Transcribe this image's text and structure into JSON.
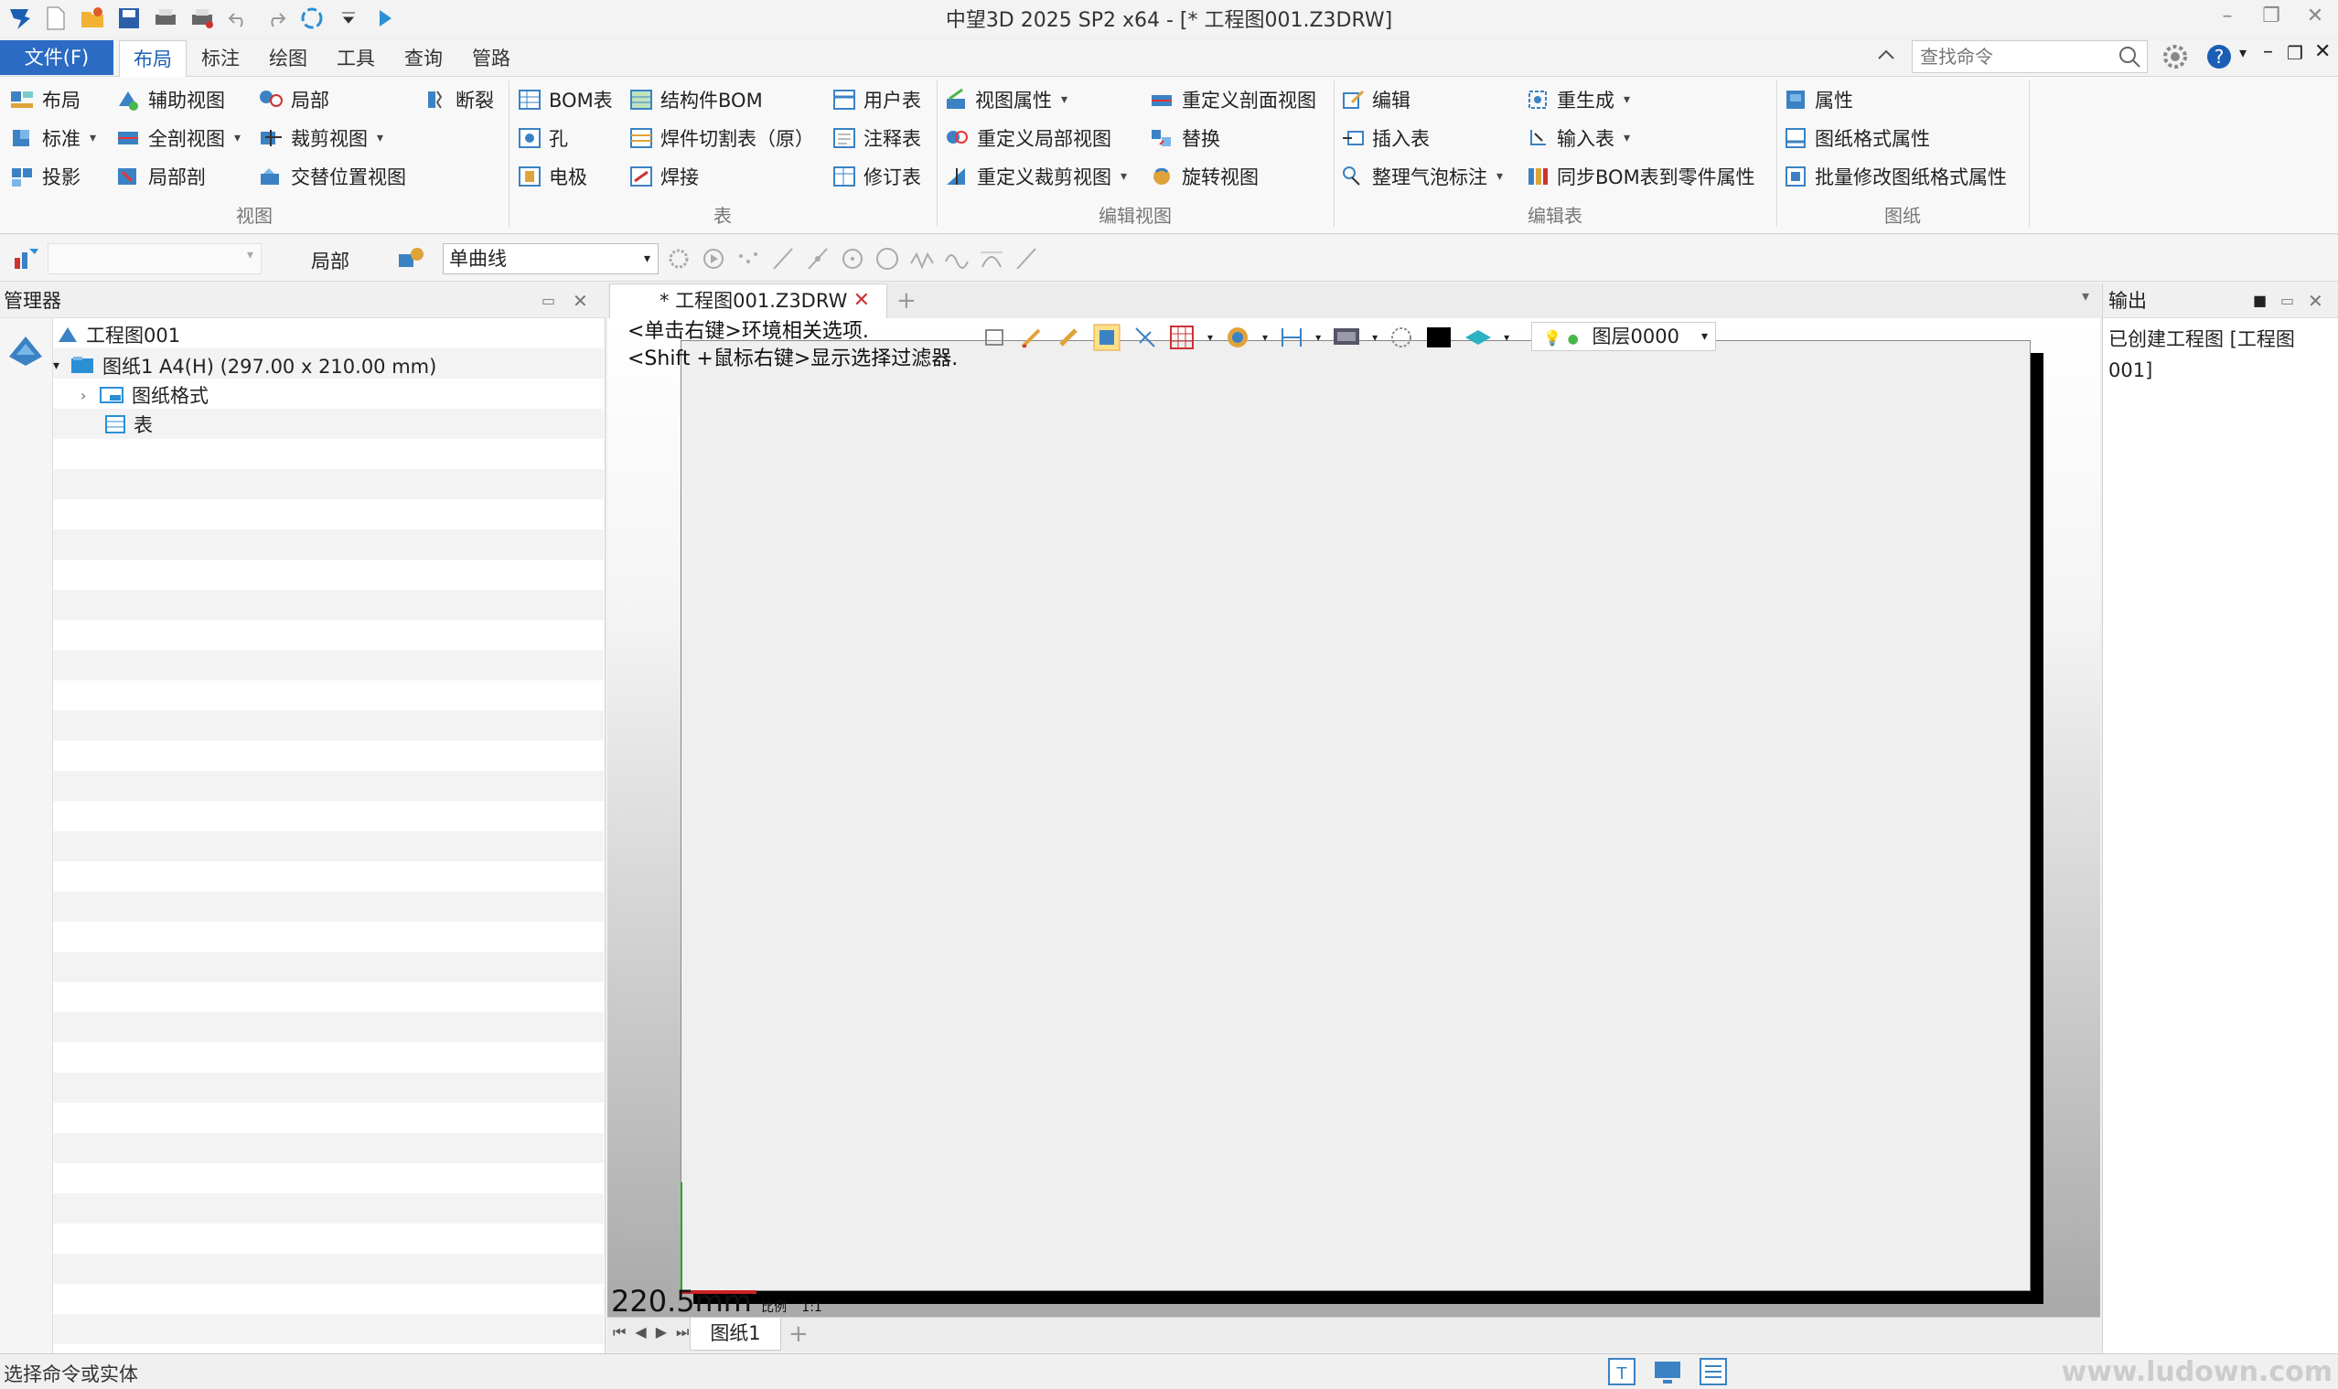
{
  "title_bar": {
    "title": "中望3D 2025 SP2 x64 - [* 工程图001.Z3DRW]",
    "quick_access": [
      "app-logo-icon",
      "new-file-icon",
      "open-folder-icon",
      "save-icon",
      "print-icon",
      "print-preview-icon",
      "undo-icon",
      "redo-icon",
      "regenerate-icon",
      "customize-dropdown-icon",
      "run-icon"
    ]
  },
  "menu": {
    "file": "文件(F)",
    "tabs": [
      "布局",
      "标注",
      "绘图",
      "工具",
      "查询",
      "管路"
    ],
    "active_tab": "布局",
    "search_placeholder": "查找命令"
  },
  "ribbon": {
    "view": {
      "label": "视图",
      "buttons": [
        "布局",
        "辅助视图",
        "局部",
        "断裂",
        "标准",
        "全剖视图",
        "裁剪视图",
        "投影",
        "局部剖",
        "交替位置视图"
      ]
    },
    "table": {
      "label": "表",
      "buttons": [
        "BOM表",
        "结构件BOM",
        "用户表",
        "孔",
        "焊件切割表（原）",
        "注释表",
        "电极",
        "焊接",
        "修订表"
      ]
    },
    "edit_view": {
      "label": "编辑视图",
      "buttons": [
        "视图属性",
        "重定义剖面视图",
        "重定义局部视图",
        "替换",
        "重定义裁剪视图",
        "旋转视图"
      ]
    },
    "edit_table": {
      "label": "编辑表",
      "buttons": [
        "编辑",
        "重生成",
        "插入表",
        "输入表",
        "整理气泡标注",
        "同步BOM表到零件属性"
      ]
    },
    "drawing": {
      "label": "图纸",
      "buttons": [
        "属性",
        "图纸格式属性",
        "批量修改图纸格式属性"
      ]
    }
  },
  "toolbar2": {
    "filter_value": "",
    "scope_label": "局部",
    "curve_type": "单曲线"
  },
  "manager": {
    "title": "管理器",
    "root": "工程图001",
    "sheet": "图纸1 A4(H) (297.00 x 210.00 mm)",
    "format": "图纸格式",
    "table": "表"
  },
  "document": {
    "tab": "* 工程图001.Z3DRW",
    "hint_line1": "<单击右键>环境相关选项.",
    "hint_line2": "<Shift +鼠标右键>显示选择过滤器.",
    "layer": "图层0000",
    "dimension_readout": "220.5mm",
    "scale_label": "比例",
    "scale_value": "1:1",
    "sheet_tab": "图纸1"
  },
  "output": {
    "title": "输出",
    "message": "已创建工程图 [工程图001]"
  },
  "status": {
    "text": "选择命令或实体",
    "watermark": "www.ludown.com"
  },
  "colors": {
    "accent": "#2b6bc4",
    "sheet_border": "#000000"
  }
}
